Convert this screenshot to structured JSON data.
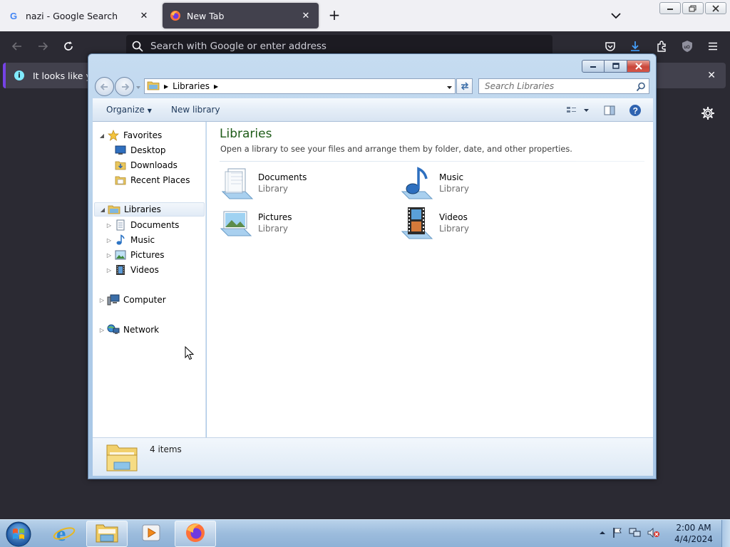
{
  "browser": {
    "tabs": [
      {
        "title": "nazi - Google Search",
        "favicon": "google-icon",
        "active": false
      },
      {
        "title": "New Tab",
        "favicon": "firefox-icon",
        "active": true
      }
    ],
    "new_tab": "+",
    "urlbar_placeholder": "Search with Google or enter address",
    "notice_text": "It looks like you"
  },
  "explorer": {
    "breadcrumb": [
      "Libraries"
    ],
    "search_placeholder": "Search Libraries",
    "toolbar": {
      "organize": "Organize",
      "new_library": "New library"
    },
    "nav": {
      "favorites": {
        "label": "Favorites",
        "items": [
          "Desktop",
          "Downloads",
          "Recent Places"
        ]
      },
      "libraries": {
        "label": "Libraries",
        "items": [
          "Documents",
          "Music",
          "Pictures",
          "Videos"
        ]
      },
      "computer": "Computer",
      "network": "Network"
    },
    "main": {
      "title": "Libraries",
      "subtitle": "Open a library to see your files and arrange them by folder, date, and other properties.",
      "libraries": [
        {
          "name": "Documents",
          "type": "Library",
          "icon": "documents-library-icon"
        },
        {
          "name": "Music",
          "type": "Library",
          "icon": "music-library-icon"
        },
        {
          "name": "Pictures",
          "type": "Library",
          "icon": "pictures-library-icon"
        },
        {
          "name": "Videos",
          "type": "Library",
          "icon": "videos-library-icon"
        }
      ]
    },
    "status": {
      "count": "4 items"
    }
  },
  "taskbar": {
    "time": "2:00 AM",
    "date": "4/4/2024"
  },
  "colors": {
    "firefox_bg": "#2b2a33",
    "notice_accent": "#7542e5",
    "library_title": "#1e5b18",
    "taskbar": "#9cbcdd"
  }
}
